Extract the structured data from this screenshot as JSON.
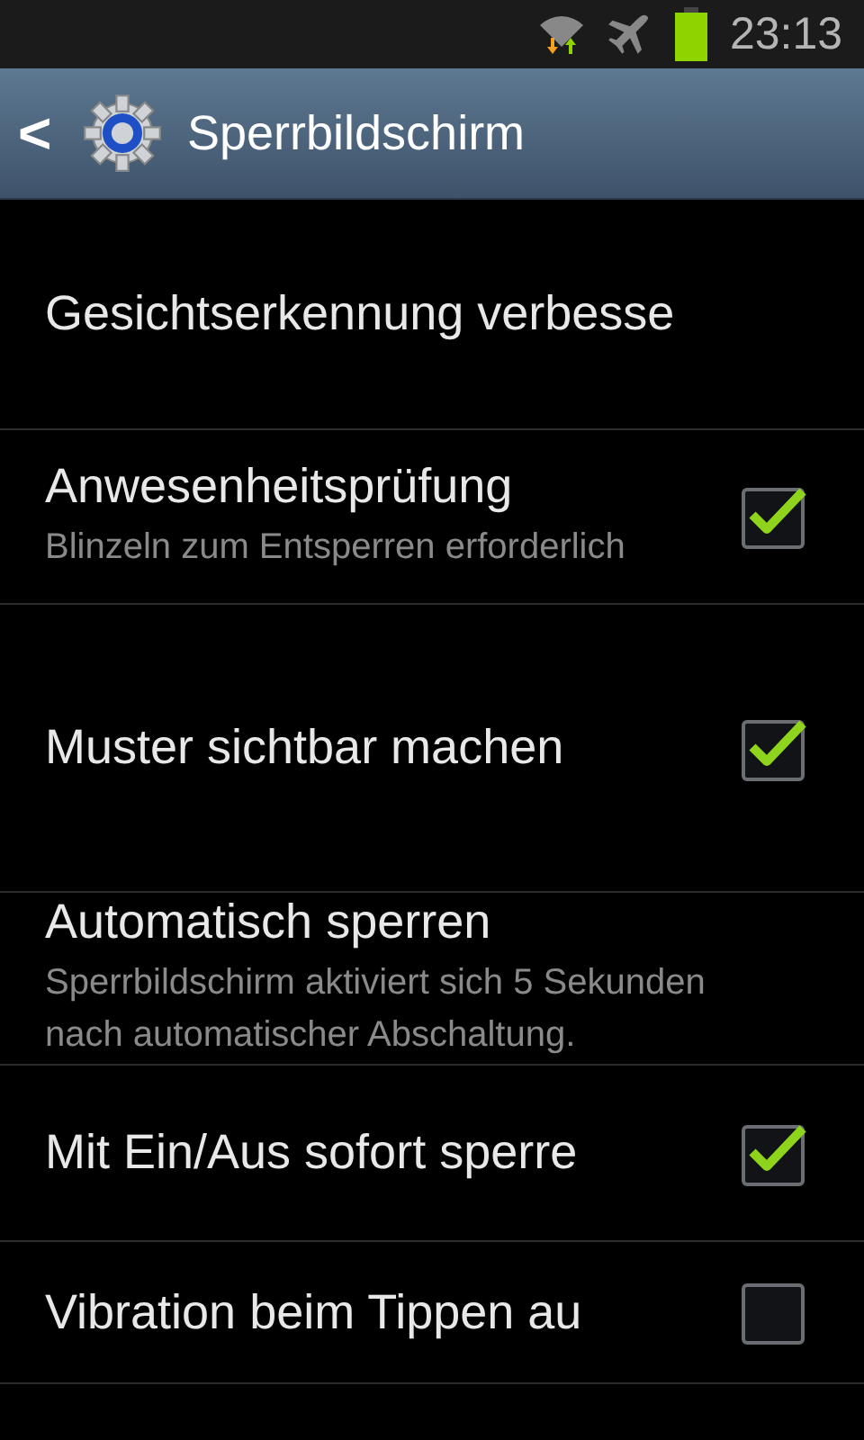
{
  "status_bar": {
    "time": "23:13"
  },
  "header": {
    "back": "<",
    "title": "Sperrbildschirm"
  },
  "settings": [
    {
      "kind": "plain",
      "title": "Gesichtserkennung verbesse"
    },
    {
      "kind": "checkbox",
      "title": "Anwesenheitsprüfung",
      "summary": "Blinzeln zum Entsperren erforderlich",
      "checked": true
    },
    {
      "kind": "checkbox",
      "title": "Muster sichtbar machen",
      "checked": true
    },
    {
      "kind": "plain",
      "title": "Automatisch sperren",
      "summary": "Sperrbildschirm aktiviert sich 5 Sekunden nach automatischer Abschaltung."
    },
    {
      "kind": "checkbox",
      "title": "Mit Ein/Aus sofort sperre",
      "checked": true
    },
    {
      "kind": "checkbox",
      "title": "Vibration beim Tippen au",
      "checked": false
    }
  ]
}
